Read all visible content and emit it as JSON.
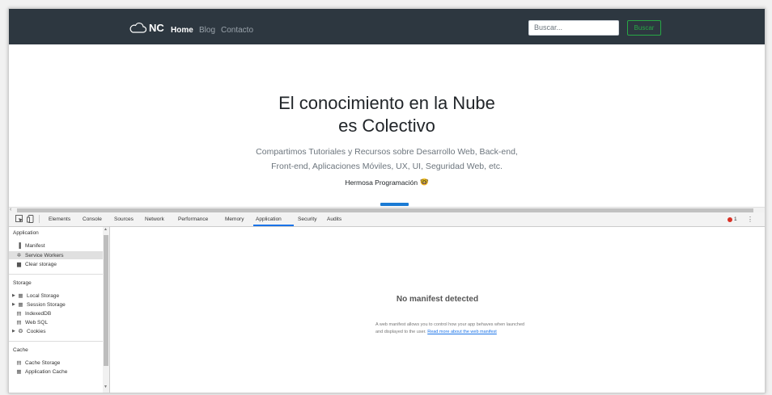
{
  "website": {
    "brand": "NC",
    "nav": {
      "home": "Home",
      "blog": "Blog",
      "contacto": "Contacto"
    },
    "search": {
      "placeholder": "Buscar...",
      "button": "Buscar"
    },
    "hero": {
      "title_line1": "El conocimiento en la Nube",
      "title_line2": "es Colectivo",
      "desc_line1": "Compartimos Tutoriales y Recursos sobre Desarrollo Web, Back-end,",
      "desc_line2": "Front-end, Aplicaciones Móviles, UX, UI, Seguridad Web, etc.",
      "tagline": "Hermosa Programación",
      "emoji": "🤓"
    }
  },
  "devtools": {
    "tabs": [
      "Elements",
      "Console",
      "Sources",
      "Network",
      "Performance",
      "Memory",
      "Application",
      "Security",
      "Audits"
    ],
    "active_tab": "Application",
    "error_count": "1",
    "sidebar": {
      "application": {
        "heading": "Application",
        "items": [
          "Manifest",
          "Service Workers",
          "Clear storage"
        ],
        "selected": "Manifest"
      },
      "storage": {
        "heading": "Storage",
        "items": [
          "Local Storage",
          "Session Storage",
          "IndexedDB",
          "Web SQL",
          "Cookies"
        ]
      },
      "cache": {
        "heading": "Cache",
        "items": [
          "Cache Storage",
          "Application Cache"
        ]
      }
    },
    "main": {
      "title": "No manifest detected",
      "desc_part1": "A web manifest allows you to control how your app behaves when launched and displayed to the user.",
      "link": "Read more about the web manifest"
    }
  },
  "colors": {
    "navbar": "#2d3740",
    "success": "#28a745",
    "accent": "#1a73e8",
    "error": "#d93025"
  }
}
